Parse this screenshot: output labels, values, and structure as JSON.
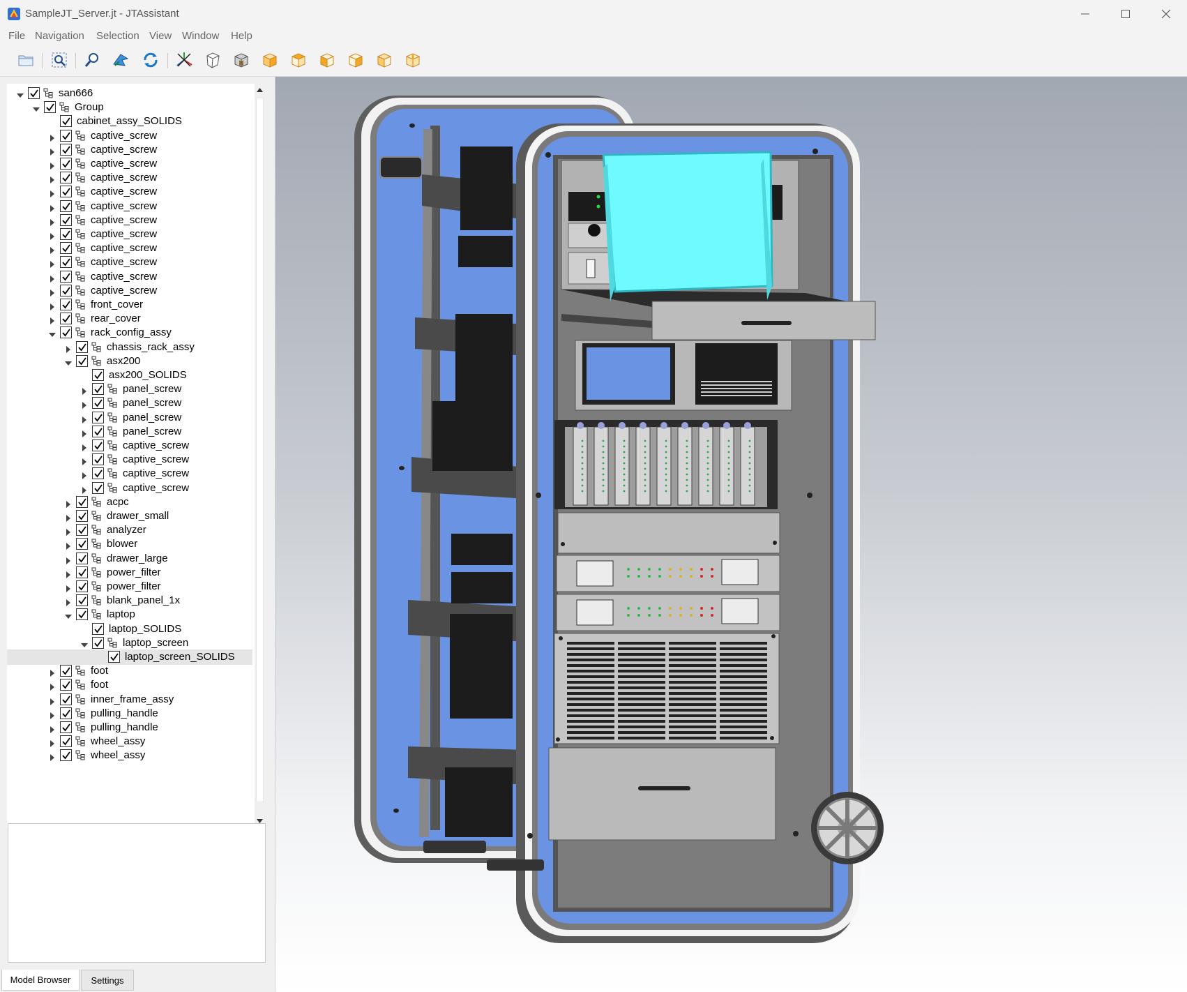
{
  "window": {
    "title": "SampleJT_Server.jt - JTAssistant",
    "controls": [
      "minimize-icon",
      "maximize-icon",
      "close-icon"
    ]
  },
  "menu": [
    "File",
    "Navigation",
    "Selection",
    "View",
    "Window",
    "Help"
  ],
  "toolbar": [
    "open-folder-icon",
    "fit-all-icon",
    "zoom-icon",
    "fly-icon",
    "rotate-icon",
    "axis-triad-icon",
    "view-wireframe-icon",
    "view-iso-icon",
    "view-front-icon",
    "view-top-icon",
    "view-left-icon",
    "view-right-icon",
    "view-bottom-icon",
    "view-back-icon"
  ],
  "tree": [
    {
      "label": "san666",
      "depth": 0,
      "toggle": "expanded",
      "icon": "assembly-icon"
    },
    {
      "label": "Group",
      "depth": 1,
      "toggle": "expanded",
      "icon": "assembly-icon"
    },
    {
      "label": "cabinet_assy_SOLIDS",
      "depth": 2,
      "toggle": "none",
      "icon": "none"
    },
    {
      "label": "captive_screw",
      "depth": 2,
      "toggle": "collapsed",
      "icon": "assembly-icon"
    },
    {
      "label": "captive_screw",
      "depth": 2,
      "toggle": "collapsed",
      "icon": "assembly-icon"
    },
    {
      "label": "captive_screw",
      "depth": 2,
      "toggle": "collapsed",
      "icon": "assembly-icon"
    },
    {
      "label": "captive_screw",
      "depth": 2,
      "toggle": "collapsed",
      "icon": "assembly-icon"
    },
    {
      "label": "captive_screw",
      "depth": 2,
      "toggle": "collapsed",
      "icon": "assembly-icon"
    },
    {
      "label": "captive_screw",
      "depth": 2,
      "toggle": "collapsed",
      "icon": "assembly-icon"
    },
    {
      "label": "captive_screw",
      "depth": 2,
      "toggle": "collapsed",
      "icon": "assembly-icon"
    },
    {
      "label": "captive_screw",
      "depth": 2,
      "toggle": "collapsed",
      "icon": "assembly-icon"
    },
    {
      "label": "captive_screw",
      "depth": 2,
      "toggle": "collapsed",
      "icon": "assembly-icon"
    },
    {
      "label": "captive_screw",
      "depth": 2,
      "toggle": "collapsed",
      "icon": "assembly-icon"
    },
    {
      "label": "captive_screw",
      "depth": 2,
      "toggle": "collapsed",
      "icon": "assembly-icon"
    },
    {
      "label": "captive_screw",
      "depth": 2,
      "toggle": "collapsed",
      "icon": "assembly-icon"
    },
    {
      "label": "front_cover",
      "depth": 2,
      "toggle": "collapsed",
      "icon": "assembly-icon"
    },
    {
      "label": "rear_cover",
      "depth": 2,
      "toggle": "collapsed",
      "icon": "assembly-icon"
    },
    {
      "label": "rack_config_assy",
      "depth": 2,
      "toggle": "expanded",
      "icon": "assembly-icon"
    },
    {
      "label": "chassis_rack_assy",
      "depth": 3,
      "toggle": "collapsed",
      "icon": "assembly-icon"
    },
    {
      "label": "asx200",
      "depth": 3,
      "toggle": "expanded",
      "icon": "assembly-icon"
    },
    {
      "label": "asx200_SOLIDS",
      "depth": 4,
      "toggle": "none",
      "icon": "none"
    },
    {
      "label": "panel_screw",
      "depth": 4,
      "toggle": "collapsed",
      "icon": "assembly-icon"
    },
    {
      "label": "panel_screw",
      "depth": 4,
      "toggle": "collapsed",
      "icon": "assembly-icon"
    },
    {
      "label": "panel_screw",
      "depth": 4,
      "toggle": "collapsed",
      "icon": "assembly-icon"
    },
    {
      "label": "panel_screw",
      "depth": 4,
      "toggle": "collapsed",
      "icon": "assembly-icon"
    },
    {
      "label": "captive_screw",
      "depth": 4,
      "toggle": "collapsed",
      "icon": "assembly-icon"
    },
    {
      "label": "captive_screw",
      "depth": 4,
      "toggle": "collapsed",
      "icon": "assembly-icon"
    },
    {
      "label": "captive_screw",
      "depth": 4,
      "toggle": "collapsed",
      "icon": "assembly-icon"
    },
    {
      "label": "captive_screw",
      "depth": 4,
      "toggle": "collapsed",
      "icon": "assembly-icon"
    },
    {
      "label": "acpc",
      "depth": 3,
      "toggle": "collapsed",
      "icon": "assembly-icon"
    },
    {
      "label": "drawer_small",
      "depth": 3,
      "toggle": "collapsed",
      "icon": "assembly-icon"
    },
    {
      "label": "analyzer",
      "depth": 3,
      "toggle": "collapsed",
      "icon": "assembly-icon"
    },
    {
      "label": "blower",
      "depth": 3,
      "toggle": "collapsed",
      "icon": "assembly-icon"
    },
    {
      "label": "drawer_large",
      "depth": 3,
      "toggle": "collapsed",
      "icon": "assembly-icon"
    },
    {
      "label": "power_filter",
      "depth": 3,
      "toggle": "collapsed",
      "icon": "assembly-icon"
    },
    {
      "label": "power_filter",
      "depth": 3,
      "toggle": "collapsed",
      "icon": "assembly-icon"
    },
    {
      "label": "blank_panel_1x",
      "depth": 3,
      "toggle": "collapsed",
      "icon": "assembly-icon"
    },
    {
      "label": "laptop",
      "depth": 3,
      "toggle": "expanded",
      "icon": "assembly-icon"
    },
    {
      "label": "laptop_SOLIDS",
      "depth": 4,
      "toggle": "none",
      "icon": "none"
    },
    {
      "label": "laptop_screen",
      "depth": 4,
      "toggle": "expanded",
      "icon": "assembly-icon"
    },
    {
      "label": "laptop_screen_SOLIDS",
      "depth": 5,
      "toggle": "none",
      "icon": "none",
      "selected": true
    },
    {
      "label": "foot",
      "depth": 2,
      "toggle": "collapsed",
      "icon": "assembly-icon"
    },
    {
      "label": "foot",
      "depth": 2,
      "toggle": "collapsed",
      "icon": "assembly-icon"
    },
    {
      "label": "inner_frame_assy",
      "depth": 2,
      "toggle": "collapsed",
      "icon": "assembly-icon"
    },
    {
      "label": "pulling_handle",
      "depth": 2,
      "toggle": "collapsed",
      "icon": "assembly-icon"
    },
    {
      "label": "pulling_handle",
      "depth": 2,
      "toggle": "collapsed",
      "icon": "assembly-icon"
    },
    {
      "label": "wheel_assy",
      "depth": 2,
      "toggle": "collapsed",
      "icon": "assembly-icon"
    },
    {
      "label": "wheel_assy",
      "depth": 2,
      "toggle": "collapsed",
      "icon": "assembly-icon"
    }
  ],
  "tabs": {
    "model_browser": "Model Browser",
    "settings": "Settings"
  },
  "colors": {
    "frame_blue": "#6b93e3",
    "frame_gray": "#6a6a6a",
    "frame_white": "#f4f4f4",
    "selected_cyan": "#6efaff",
    "rack_metal": "#b9b9b9",
    "dark_box": "#1c1c1c"
  }
}
